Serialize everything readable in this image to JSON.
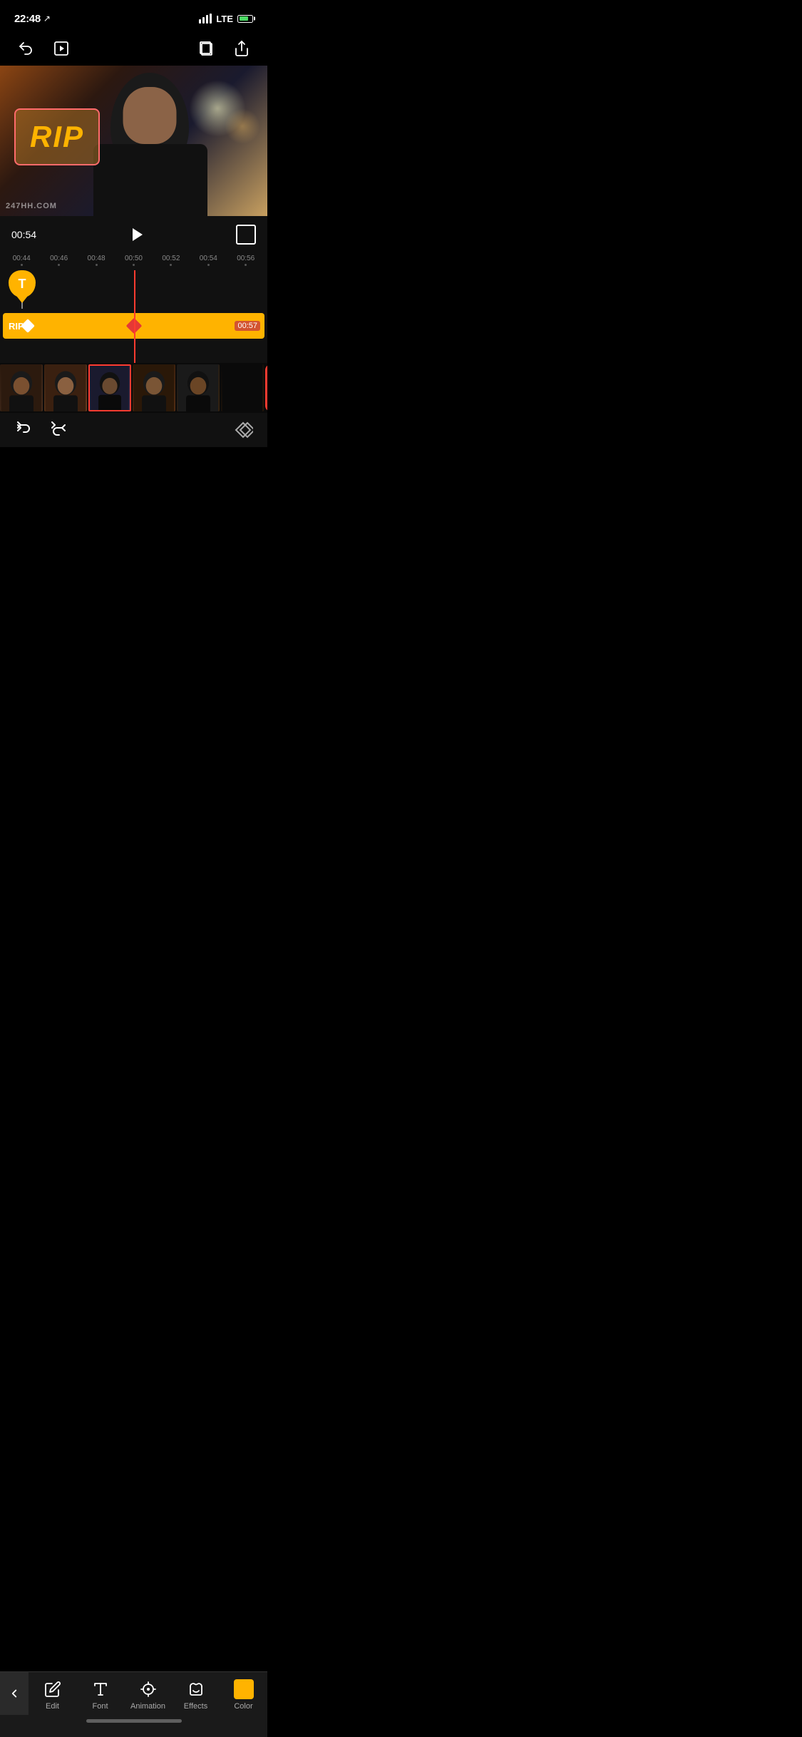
{
  "statusBar": {
    "time": "22:48",
    "navArrow": "↗",
    "lte": "LTE",
    "signalBars": [
      6,
      9,
      12,
      14
    ],
    "batteryPercent": 75
  },
  "topToolbar": {
    "undoIcon": "undo",
    "playIcon": "play",
    "bookmarkIcon": "bookmark",
    "shareIcon": "share"
  },
  "videoPreview": {
    "ripText": "RIP",
    "watermark": "247HH.COM"
  },
  "timelineControls": {
    "currentTime": "00:54",
    "playLabel": "play",
    "fullscreenLabel": "fullscreen"
  },
  "rulerMarks": [
    "00:44",
    "00:46",
    "00:48",
    "00:50",
    "00:52",
    "00:54",
    "00:56"
  ],
  "ripTrack": {
    "label": "RIP",
    "duration": "00:57"
  },
  "bottomToolbar": {
    "chevronLabel": "<",
    "items": [
      {
        "id": "edit",
        "label": "Edit",
        "icon": "edit-icon"
      },
      {
        "id": "font",
        "label": "Font",
        "icon": "font-icon"
      },
      {
        "id": "animation",
        "label": "Animation",
        "icon": "animation-icon"
      },
      {
        "id": "effects",
        "label": "Effects",
        "icon": "effects-icon"
      },
      {
        "id": "color",
        "label": "Color",
        "icon": "color-icon"
      }
    ]
  },
  "actionBar": {
    "undoIcon": "undo-icon",
    "redoIcon": "redo-icon",
    "keyframeIcon": "keyframe-icon"
  }
}
